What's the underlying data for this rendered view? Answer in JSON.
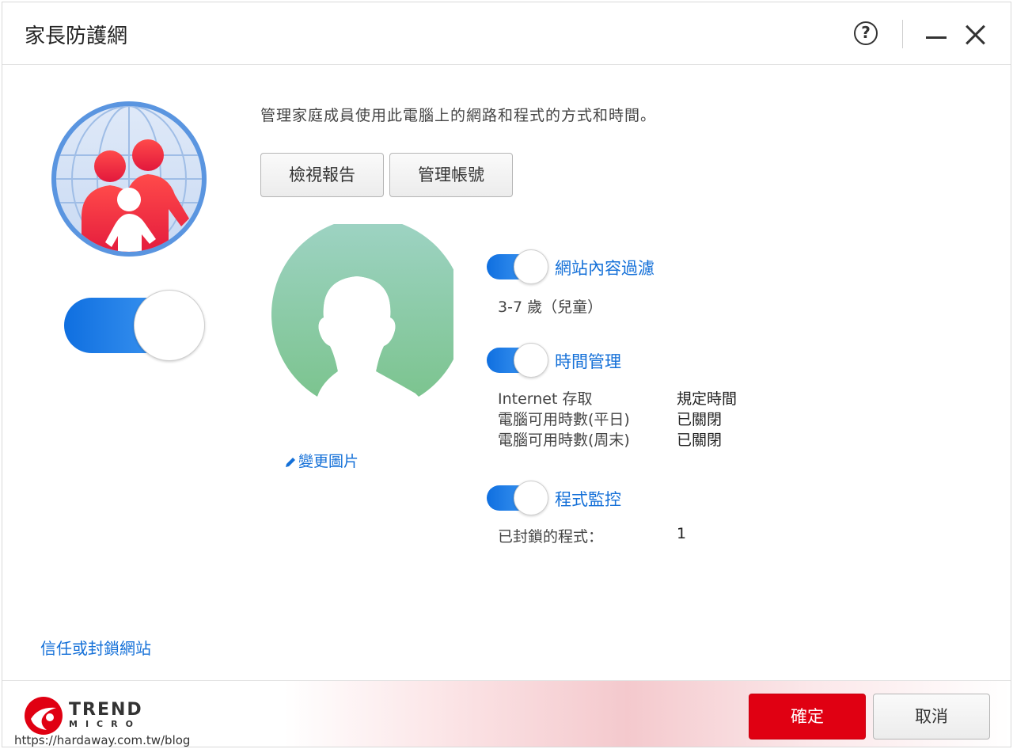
{
  "window": {
    "title": "家長防護網",
    "help_label": "?"
  },
  "main_toggle": {
    "state": "on"
  },
  "description": "管理家庭成員使用此電腦上的網路和程式的方式和時間。",
  "buttons": {
    "view_report": "檢視報告",
    "manage_account": "管理帳號"
  },
  "profile": {
    "change_picture": "變更圖片"
  },
  "sections": {
    "web_filter": {
      "title": "網站內容過濾",
      "state": "on",
      "detail": "3-7 歲（兒童）"
    },
    "time_management": {
      "title": "時間管理",
      "state": "on",
      "rows": [
        {
          "label": "Internet 存取",
          "value": "規定時間"
        },
        {
          "label": "電腦可用時數(平日)",
          "value": "已關閉"
        },
        {
          "label": "電腦可用時數(周末)",
          "value": "已關閉"
        }
      ]
    },
    "program_control": {
      "title": "程式監控",
      "state": "on",
      "blocked_label": "已封鎖的程式：",
      "blocked_count": "1"
    }
  },
  "links": {
    "trust_block": "信任或封鎖網站"
  },
  "footer": {
    "brand_line1": "TREND",
    "brand_line2": "MICRO",
    "ok": "確定",
    "cancel": "取消"
  },
  "watermark": "https://hardaway.com.tw/blog",
  "colors": {
    "accent_blue": "#1470d8",
    "toggle_blue": "#0f6fe0",
    "ok_red": "#e00012",
    "avatar_green": "#8ccaa6"
  }
}
